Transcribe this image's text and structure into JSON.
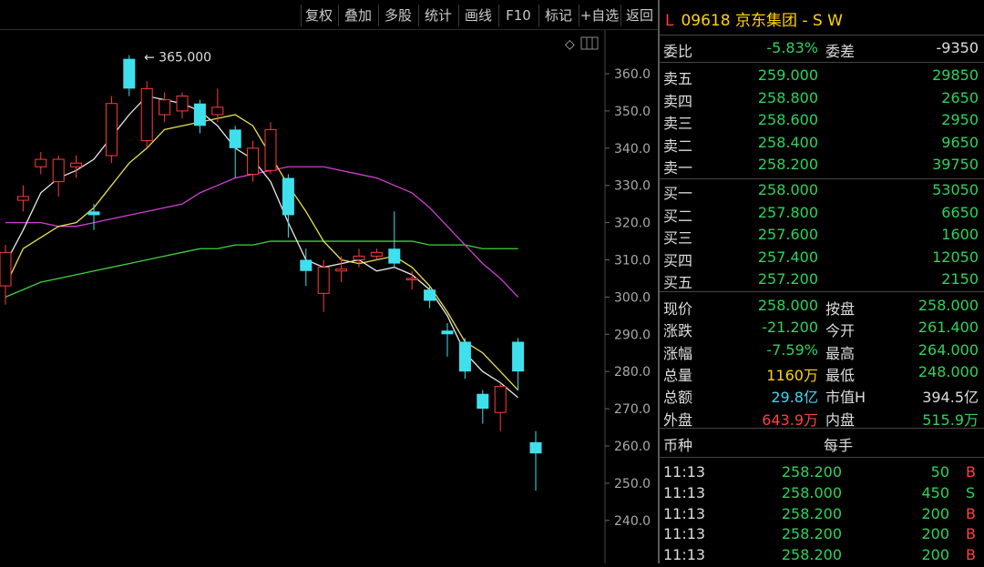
{
  "toolbar": {
    "buttons": [
      "复权",
      "叠加",
      "多股",
      "统计",
      "画线",
      "F10",
      "标记",
      "+自选",
      "返回"
    ]
  },
  "chart": {
    "high_marker_label": "365.000",
    "y_axis_ticks": [
      "360.0",
      "350.0",
      "340.0",
      "330.0",
      "320.0",
      "310.0",
      "300.0",
      "290.0",
      "280.0",
      "270.0",
      "260.0",
      "250.0",
      "240.0"
    ],
    "colors": {
      "up": "#ff3b3b",
      "down": "#3fe0ee",
      "ma_white": "#e8e8e8",
      "ma_yellow": "#e8e050",
      "ma_magenta": "#d040d0",
      "ma_green": "#40d040"
    }
  },
  "chart_data": {
    "type": "candlestick",
    "y_axis_range": [
      240,
      368
    ],
    "candles": [
      {
        "o": 303,
        "c": 312,
        "h": 314,
        "l": 298
      },
      {
        "o": 326,
        "c": 327,
        "h": 330,
        "l": 323
      },
      {
        "o": 335,
        "c": 337,
        "h": 339,
        "l": 333
      },
      {
        "o": 331,
        "c": 337,
        "h": 338,
        "l": 327
      },
      {
        "o": 335,
        "c": 336,
        "h": 338,
        "l": 332
      },
      {
        "o": 323,
        "c": 322,
        "h": 325,
        "l": 318
      },
      {
        "o": 338,
        "c": 352,
        "h": 354,
        "l": 336
      },
      {
        "o": 364,
        "c": 356,
        "h": 365,
        "l": 354
      },
      {
        "o": 342,
        "c": 356,
        "h": 358,
        "l": 340
      },
      {
        "o": 349,
        "c": 353,
        "h": 355,
        "l": 347
      },
      {
        "o": 350,
        "c": 354,
        "h": 355,
        "l": 348
      },
      {
        "o": 352,
        "c": 346,
        "h": 353,
        "l": 344
      },
      {
        "o": 349,
        "c": 351,
        "h": 356,
        "l": 347
      },
      {
        "o": 345,
        "c": 340,
        "h": 346,
        "l": 332
      },
      {
        "o": 333,
        "c": 340,
        "h": 342,
        "l": 331
      },
      {
        "o": 334,
        "c": 345,
        "h": 347,
        "l": 333
      },
      {
        "o": 332,
        "c": 322,
        "h": 333,
        "l": 316
      },
      {
        "o": 310,
        "c": 307,
        "h": 313,
        "l": 303
      },
      {
        "o": 301,
        "c": 308,
        "h": 310,
        "l": 296
      },
      {
        "o": 307,
        "c": 307.5,
        "h": 311,
        "l": 304
      },
      {
        "o": 310,
        "c": 311,
        "h": 313,
        "l": 308
      },
      {
        "o": 311,
        "c": 312,
        "h": 313,
        "l": 310
      },
      {
        "o": 313,
        "c": 309,
        "h": 323,
        "l": 308
      },
      {
        "o": 305,
        "c": 305,
        "h": 307,
        "l": 302
      },
      {
        "o": 302,
        "c": 299,
        "h": 303,
        "l": 297
      },
      {
        "o": 291,
        "c": 290,
        "h": 293,
        "l": 284
      },
      {
        "o": 288,
        "c": 280,
        "h": 289,
        "l": 278
      },
      {
        "o": 274,
        "c": 270,
        "h": 275,
        "l": 266
      },
      {
        "o": 269,
        "c": 276,
        "h": 277,
        "l": 264
      },
      {
        "o": 288,
        "c": 280,
        "h": 289,
        "l": 275
      },
      {
        "o": 261,
        "c": 258,
        "h": 264,
        "l": 248
      }
    ],
    "ma_white": [
      309,
      318,
      328,
      332,
      334,
      337,
      343,
      349,
      354,
      353,
      352,
      350,
      346,
      340,
      337,
      331,
      320,
      310,
      308,
      309,
      310,
      307,
      308,
      306,
      302,
      295,
      285,
      280,
      277,
      273
    ],
    "ma_yellow": [
      303,
      313,
      316,
      319,
      320,
      324,
      330,
      336,
      340,
      345,
      346,
      347,
      348,
      349,
      346,
      338,
      330,
      323,
      315,
      310,
      309,
      310,
      311,
      308,
      303,
      296,
      288,
      285,
      280,
      275
    ],
    "ma_magenta": [
      320,
      320,
      320,
      319,
      319,
      320,
      321,
      322,
      323,
      324,
      325,
      328,
      330,
      332,
      333,
      334,
      335,
      335,
      335,
      334,
      333,
      332,
      330,
      328,
      324,
      319,
      314,
      309,
      305,
      300
    ],
    "ma_green": [
      300,
      302,
      304,
      305,
      306,
      307,
      308,
      309,
      310,
      311,
      312,
      313,
      313,
      314,
      314,
      315,
      315,
      315,
      315,
      315,
      315,
      315,
      315,
      315,
      314,
      314,
      314,
      313,
      313,
      313
    ]
  },
  "panel": {
    "title_tag": "L",
    "title": "09618 京东集团 - S W",
    "webi": {
      "label": "委比",
      "value": "-5.83%",
      "label2": "委差",
      "value2": "-9350"
    },
    "asks": [
      {
        "label": "卖五",
        "price": "259.000",
        "vol": "29850"
      },
      {
        "label": "卖四",
        "price": "258.800",
        "vol": "2650"
      },
      {
        "label": "卖三",
        "price": "258.600",
        "vol": "2950"
      },
      {
        "label": "卖二",
        "price": "258.400",
        "vol": "9650"
      },
      {
        "label": "卖一",
        "price": "258.200",
        "vol": "39750"
      }
    ],
    "bids": [
      {
        "label": "买一",
        "price": "258.000",
        "vol": "53050"
      },
      {
        "label": "买二",
        "price": "257.800",
        "vol": "6650"
      },
      {
        "label": "买三",
        "price": "257.600",
        "vol": "1600"
      },
      {
        "label": "买四",
        "price": "257.400",
        "vol": "12050"
      },
      {
        "label": "买五",
        "price": "257.200",
        "vol": "2150"
      }
    ],
    "stats": [
      {
        "l1": "现价",
        "v1": "258.000",
        "l2": "按盘",
        "v2": "258.000",
        "c1": "green",
        "c2": "green"
      },
      {
        "l1": "涨跌",
        "v1": "-21.200",
        "l2": "今开",
        "v2": "261.400",
        "c1": "green",
        "c2": "green"
      },
      {
        "l1": "涨幅",
        "v1": "-7.59%",
        "l2": "最高",
        "v2": "264.000",
        "c1": "green",
        "c2": "green"
      },
      {
        "l1": "总量",
        "v1": "1160万",
        "l2": "最低",
        "v2": "248.000",
        "c1": "yellow",
        "c2": "green"
      },
      {
        "l1": "总额",
        "v1": "29.8亿",
        "l2": "市值H",
        "v2": "394.5亿",
        "c1": "cyan",
        "c2": "white"
      },
      {
        "l1": "外盘",
        "v1": "643.9万",
        "l2": "内盘",
        "v2": "515.9万",
        "c1": "red",
        "c2": "green"
      }
    ],
    "currency": {
      "label": "币种",
      "label2": "每手"
    },
    "trades": [
      {
        "time": "11:13",
        "price": "258.200",
        "vol": "50",
        "side": "B"
      },
      {
        "time": "11:13",
        "price": "258.000",
        "vol": "450",
        "side": "S"
      },
      {
        "time": "11:13",
        "price": "258.200",
        "vol": "200",
        "side": "B"
      },
      {
        "time": "11:13",
        "price": "258.200",
        "vol": "200",
        "side": "B"
      },
      {
        "time": "11:13",
        "price": "258.200",
        "vol": "200",
        "side": "B"
      }
    ]
  }
}
